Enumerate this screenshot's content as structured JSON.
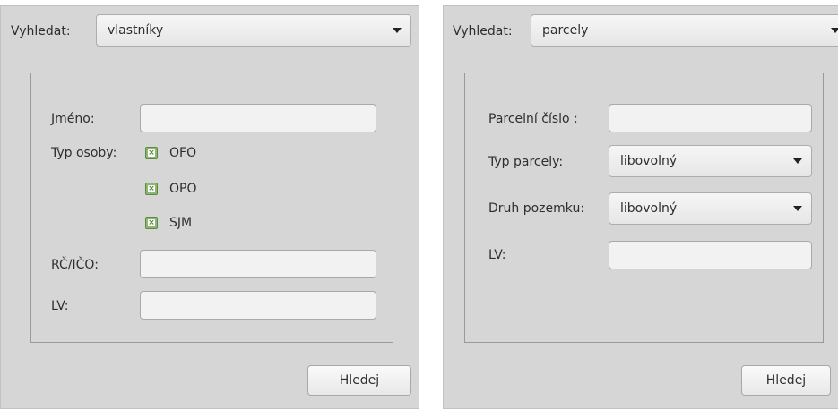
{
  "left": {
    "search": {
      "label": "Vyhledat:",
      "selected": "vlastníky"
    },
    "fields": {
      "name_label": "Jméno:",
      "name_value": "",
      "person_type_label": "Typ osoby:",
      "person_types": [
        {
          "label": "OFO",
          "checked": true
        },
        {
          "label": "OPO",
          "checked": true
        },
        {
          "label": "SJM",
          "checked": true
        }
      ],
      "rcico_label": "RČ/IČO:",
      "rcico_value": "",
      "lv_label": "LV:",
      "lv_value": ""
    },
    "search_button": "Hledej"
  },
  "right": {
    "search": {
      "label": "Vyhledat:",
      "selected": "parcely"
    },
    "fields": {
      "parcel_number_label": "Parcelní číslo :",
      "parcel_number_value": "",
      "parcel_type_label": "Typ parcely:",
      "parcel_type_selected": "libovolný",
      "land_type_label": "Druh pozemku:",
      "land_type_selected": "libovolný",
      "lv_label": "LV:",
      "lv_value": ""
    },
    "search_button": "Hledej"
  },
  "colors": {
    "panel_bg": "#d6d6d6",
    "checkbox_green": "#8bb86e"
  }
}
